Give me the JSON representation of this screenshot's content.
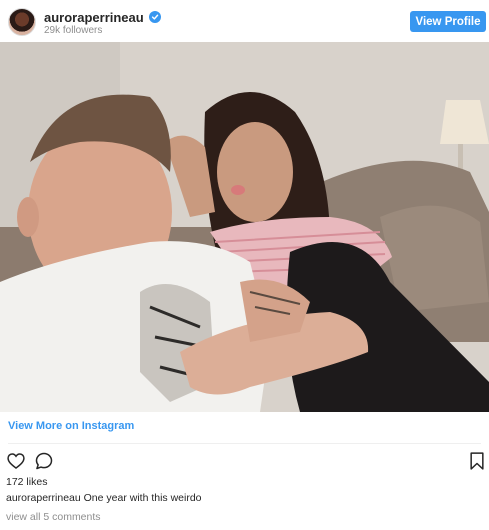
{
  "header": {
    "username": "auroraperrineau",
    "followers": "29k followers",
    "view_profile_label": "View Profile",
    "avatar_icon": "profile-avatar",
    "verified_icon": "verified-badge-icon",
    "accent_color": "#3897f0"
  },
  "post": {
    "view_more_label": "View More on Instagram",
    "likes": "172 likes",
    "caption_user": "auroraperrineau",
    "caption_text": "One year with this weirdo",
    "view_comments": "view all 5 comments",
    "icons": [
      "heart-icon",
      "comment-icon",
      "bookmark-icon"
    ]
  }
}
